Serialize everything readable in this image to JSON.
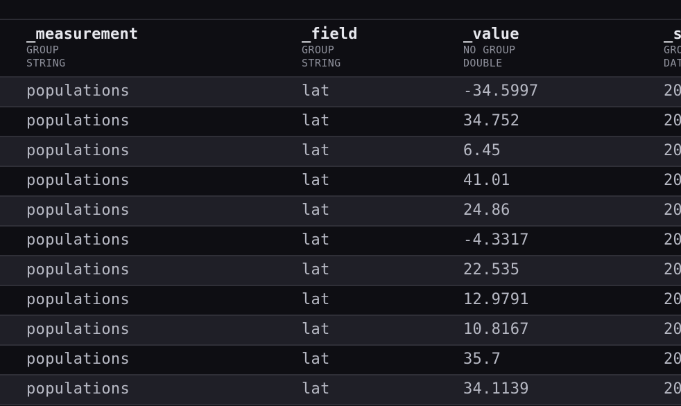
{
  "columns": [
    {
      "name": "_measurement",
      "group": "GROUP",
      "type": "STRING"
    },
    {
      "name": "_field",
      "group": "GROUP",
      "type": "STRING"
    },
    {
      "name": "_value",
      "group": "NO GROUP",
      "type": "DOUBLE"
    },
    {
      "name": "_s",
      "group": "GRO",
      "type": "DAT"
    }
  ],
  "rows": [
    [
      "populations",
      "lat",
      "-34.5997",
      "20"
    ],
    [
      "populations",
      "lat",
      "34.752",
      "20"
    ],
    [
      "populations",
      "lat",
      "6.45",
      "20"
    ],
    [
      "populations",
      "lat",
      "41.01",
      "20"
    ],
    [
      "populations",
      "lat",
      "24.86",
      "20"
    ],
    [
      "populations",
      "lat",
      "-4.3317",
      "20"
    ],
    [
      "populations",
      "lat",
      "22.535",
      "20"
    ],
    [
      "populations",
      "lat",
      "12.9791",
      "20"
    ],
    [
      "populations",
      "lat",
      "10.8167",
      "20"
    ],
    [
      "populations",
      "lat",
      "35.7",
      "20"
    ],
    [
      "populations",
      "lat",
      "34.1139",
      "20"
    ]
  ]
}
